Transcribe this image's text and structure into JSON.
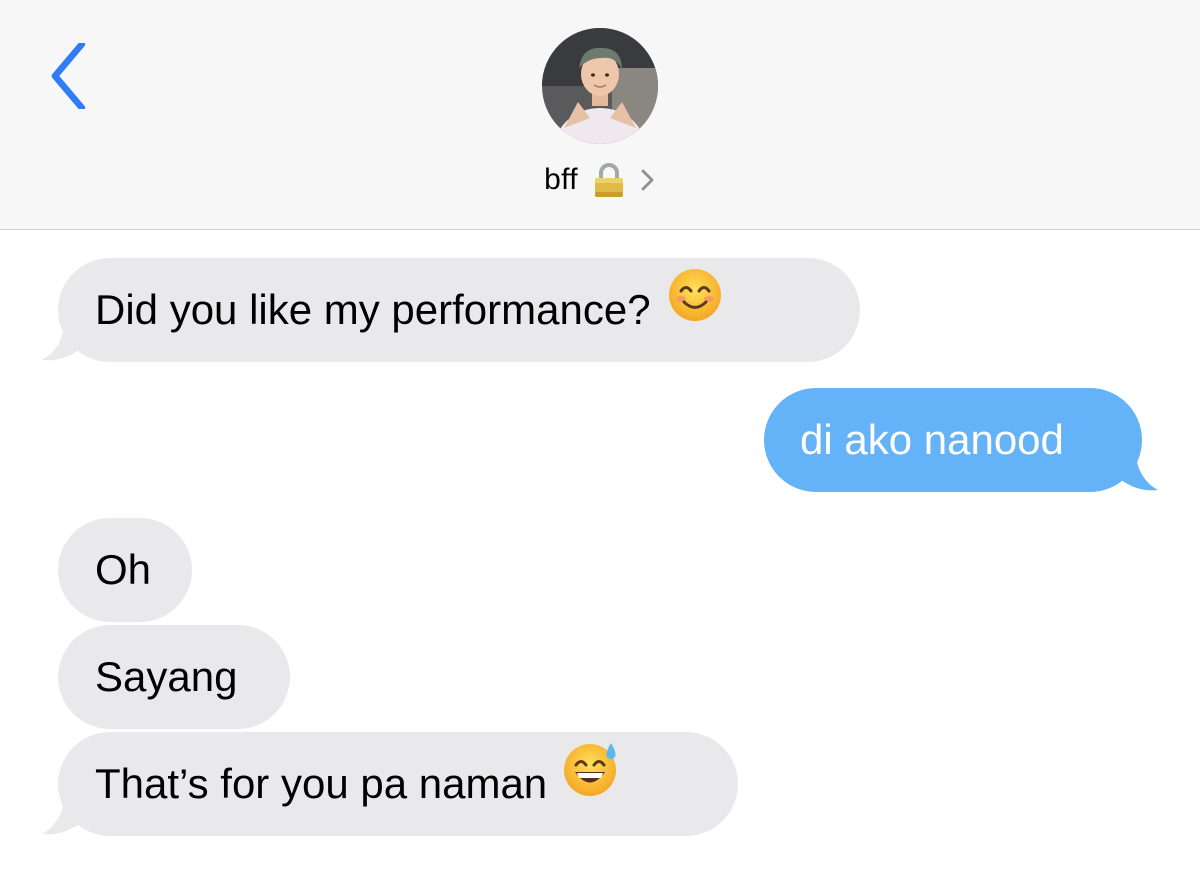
{
  "header": {
    "contact_name": "bff",
    "contact_emoji": "lock-icon",
    "back_icon": "chevron-left-icon",
    "details_icon": "chevron-right-icon",
    "accent_color": "#2f7cf6"
  },
  "messages": [
    {
      "direction": "incoming",
      "text": "Did you like my performance?",
      "emoji": "smiling-face-icon"
    },
    {
      "direction": "outgoing",
      "text": "di ako nanood"
    },
    {
      "direction": "incoming",
      "text": "Oh"
    },
    {
      "direction": "incoming",
      "text": "Sayang"
    },
    {
      "direction": "incoming",
      "text": "That’s for you pa naman",
      "emoji": "grinning-sweat-face-icon"
    }
  ],
  "colors": {
    "incoming_bubble": "#e9e9eb",
    "outgoing_bubble": "#64b2f7",
    "header_bg": "#f7f7f7"
  }
}
